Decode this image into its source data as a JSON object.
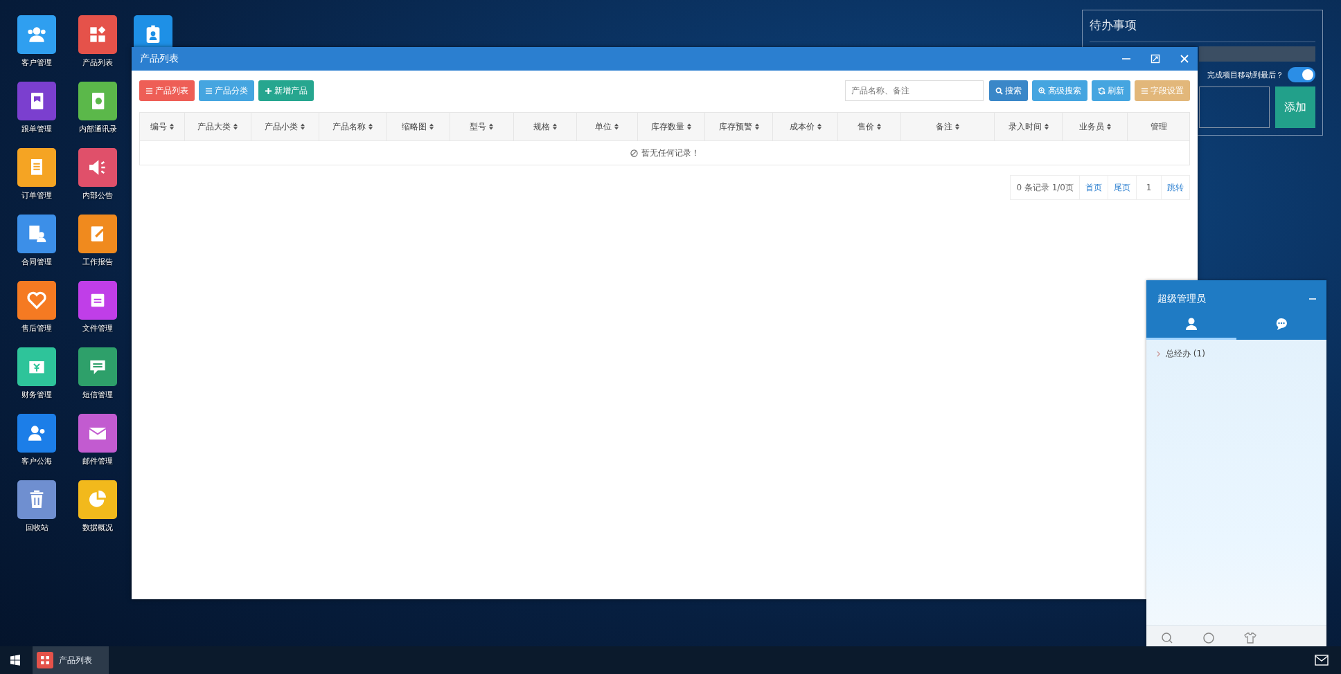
{
  "desktop": {
    "icons": [
      {
        "label": "客户管理",
        "color": "#2f9ff0"
      },
      {
        "label": "产品列表",
        "color": "#e5524a"
      },
      {
        "label": "跟单管理",
        "color": "#7b3fcf"
      },
      {
        "label": "内部通讯录",
        "color": "#5bb84a"
      },
      {
        "label": "订单管理",
        "color": "#f5a423"
      },
      {
        "label": "内部公告",
        "color": "#e0506a"
      },
      {
        "label": "合同管理",
        "color": "#3c8fe8"
      },
      {
        "label": "工作报告",
        "color": "#f08a1e"
      },
      {
        "label": "售后管理",
        "color": "#f57a22"
      },
      {
        "label": "文件管理",
        "color": "#c03ee8"
      },
      {
        "label": "财务管理",
        "color": "#2ec49a"
      },
      {
        "label": "短信管理",
        "color": "#2ea06a"
      },
      {
        "label": "客户公海",
        "color": "#1c7ee8"
      },
      {
        "label": "邮件管理",
        "color": "#c25bd0"
      },
      {
        "label": "回收站",
        "color": "#6f8fd0"
      },
      {
        "label": "数据概况",
        "color": "#f2b91c"
      }
    ],
    "extra_icon": {
      "color": "#1e90e6"
    }
  },
  "window": {
    "title": "产品列表",
    "toolbar": [
      {
        "label": "产品列表",
        "color": "#ee5e56"
      },
      {
        "label": "产品分类",
        "color": "#45a5e0"
      },
      {
        "label": "新增产品",
        "color": "#26a68f"
      }
    ],
    "search": {
      "placeholder": "产品名称、备注"
    },
    "actions": [
      {
        "label": "搜索",
        "color": "#3a87c8"
      },
      {
        "label": "高级搜索",
        "color": "#45a5e0"
      },
      {
        "label": "刷新",
        "color": "#45a5e0"
      },
      {
        "label": "字段设置",
        "color": "#e2b77a"
      }
    ],
    "table": {
      "columns": [
        {
          "label": "编号",
          "sortable": true
        },
        {
          "label": "产品大类",
          "sortable": true
        },
        {
          "label": "产品小类",
          "sortable": true
        },
        {
          "label": "产品名称",
          "sortable": true
        },
        {
          "label": "缩略图",
          "sortable": true
        },
        {
          "label": "型号",
          "sortable": true
        },
        {
          "label": "规格",
          "sortable": true
        },
        {
          "label": "单位",
          "sortable": true
        },
        {
          "label": "库存数量",
          "sortable": true
        },
        {
          "label": "库存预警",
          "sortable": true
        },
        {
          "label": "成本价",
          "sortable": true
        },
        {
          "label": "售价",
          "sortable": true
        },
        {
          "label": "备注",
          "sortable": true
        },
        {
          "label": "录入时间",
          "sortable": true
        },
        {
          "label": "业务员",
          "sortable": true
        },
        {
          "label": "管理",
          "sortable": false
        }
      ],
      "empty_message": "暂无任何记录！"
    },
    "pagination": {
      "summary": "0 条记录 1/0页",
      "first": "首页",
      "last": "尾页",
      "page": "1",
      "jump": "跳转"
    }
  },
  "todo": {
    "title": "待办事项",
    "move_label": "完成项目移动到最后？",
    "move_on": true,
    "add_button": "添加"
  },
  "chat": {
    "title": "超级管理员",
    "tabs": [
      {
        "selected": true
      },
      {
        "selected": false
      }
    ],
    "groups": [
      {
        "label": "总经办 (1)",
        "expanded": false
      }
    ]
  },
  "taskbar": {
    "tasks": [
      {
        "label": "产品列表",
        "selected": true
      }
    ]
  }
}
